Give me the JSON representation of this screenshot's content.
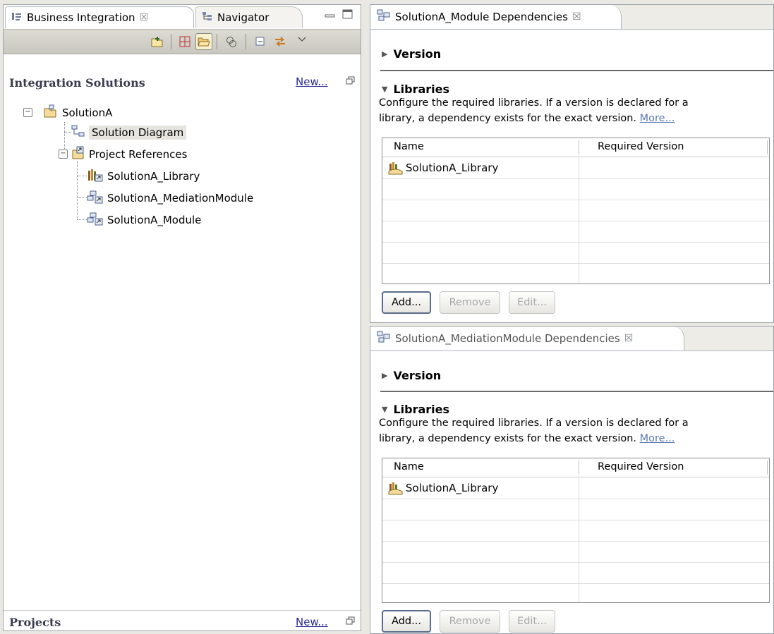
{
  "left_view": {
    "tabs": [
      {
        "label": "Business Integration",
        "close": "☒"
      },
      {
        "label": "Navigator"
      }
    ],
    "integration_solutions": {
      "title": "Integration Solutions",
      "new_link": "New...",
      "tree": {
        "root": "SolutionA",
        "children": [
          "Solution Diagram",
          "Project References"
        ],
        "references": [
          "SolutionA_Library",
          "SolutionA_MediationModule",
          "SolutionA_Module"
        ]
      }
    },
    "projects": {
      "title": "Projects",
      "new_link": "New..."
    }
  },
  "editors": [
    {
      "tab_label": "SolutionA_Module Dependencies",
      "close": "☒",
      "version_section": "Version",
      "libraries_section": "Libraries",
      "description_line1": "Configure the required libraries.  If a version is declared for a",
      "description_line2": "library, a dependency exists for the exact version.",
      "more_link": "More...",
      "table": {
        "columns": [
          "Name",
          "Required Version"
        ],
        "rows": [
          {
            "name": "SolutionA_Library",
            "version": ""
          }
        ]
      },
      "buttons": {
        "add": "Add...",
        "remove": "Remove",
        "edit": "Edit..."
      }
    },
    {
      "tab_label": "SolutionA_MediationModule Dependencies",
      "close": "☒",
      "version_section": "Version",
      "libraries_section": "Libraries",
      "description_line1": "Configure the required libraries.  If a version is declared for a",
      "description_line2": "library, a dependency exists for the exact version.",
      "more_link": "More...",
      "table": {
        "columns": [
          "Name",
          "Required Version"
        ],
        "rows": [
          {
            "name": "SolutionA_Library",
            "version": ""
          }
        ]
      },
      "buttons": {
        "add": "Add...",
        "remove": "Remove",
        "edit": "Edit..."
      }
    }
  ]
}
